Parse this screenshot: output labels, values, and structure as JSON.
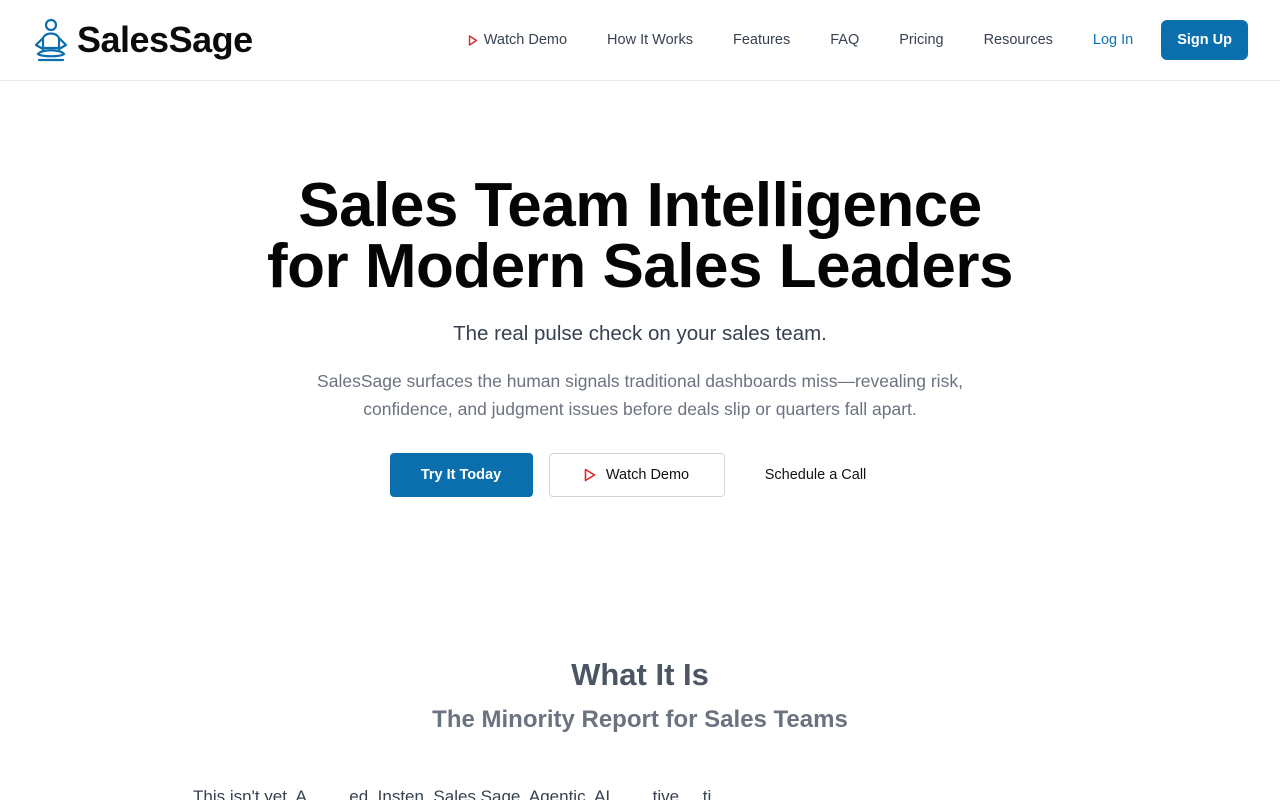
{
  "brand": {
    "name": "SalesSage",
    "logo_icon": "meditating-figure-icon",
    "accent_color": "#0b6fae"
  },
  "nav": {
    "items": [
      {
        "label": "Watch Demo",
        "icon": "play-icon"
      },
      {
        "label": "How It Works"
      },
      {
        "label": "Features"
      },
      {
        "label": "FAQ"
      },
      {
        "label": "Pricing"
      },
      {
        "label": "Resources"
      }
    ],
    "login_label": "Log In",
    "signup_label": "Sign Up"
  },
  "hero": {
    "title_line1": "Sales Team Intelligence",
    "title_line2": "for Modern Sales Leaders",
    "tagline": "The real pulse check on your sales team.",
    "description": "SalesSage surfaces the human signals traditional dashboards miss—revealing risk, confidence, and judgment issues before deals slip or quarters fall apart.",
    "cta_primary": "Try It Today",
    "cta_secondary": "Watch Demo",
    "cta_tertiary": "Schedule a Call"
  },
  "section": {
    "title": "What It Is",
    "subtitle": "The Minority Report for Sales Teams",
    "body_partial": "This isn't yet. A. ... ...ed. Insten. Sales Sage. Agentic. AI. ... ...tive. ...ti..."
  }
}
